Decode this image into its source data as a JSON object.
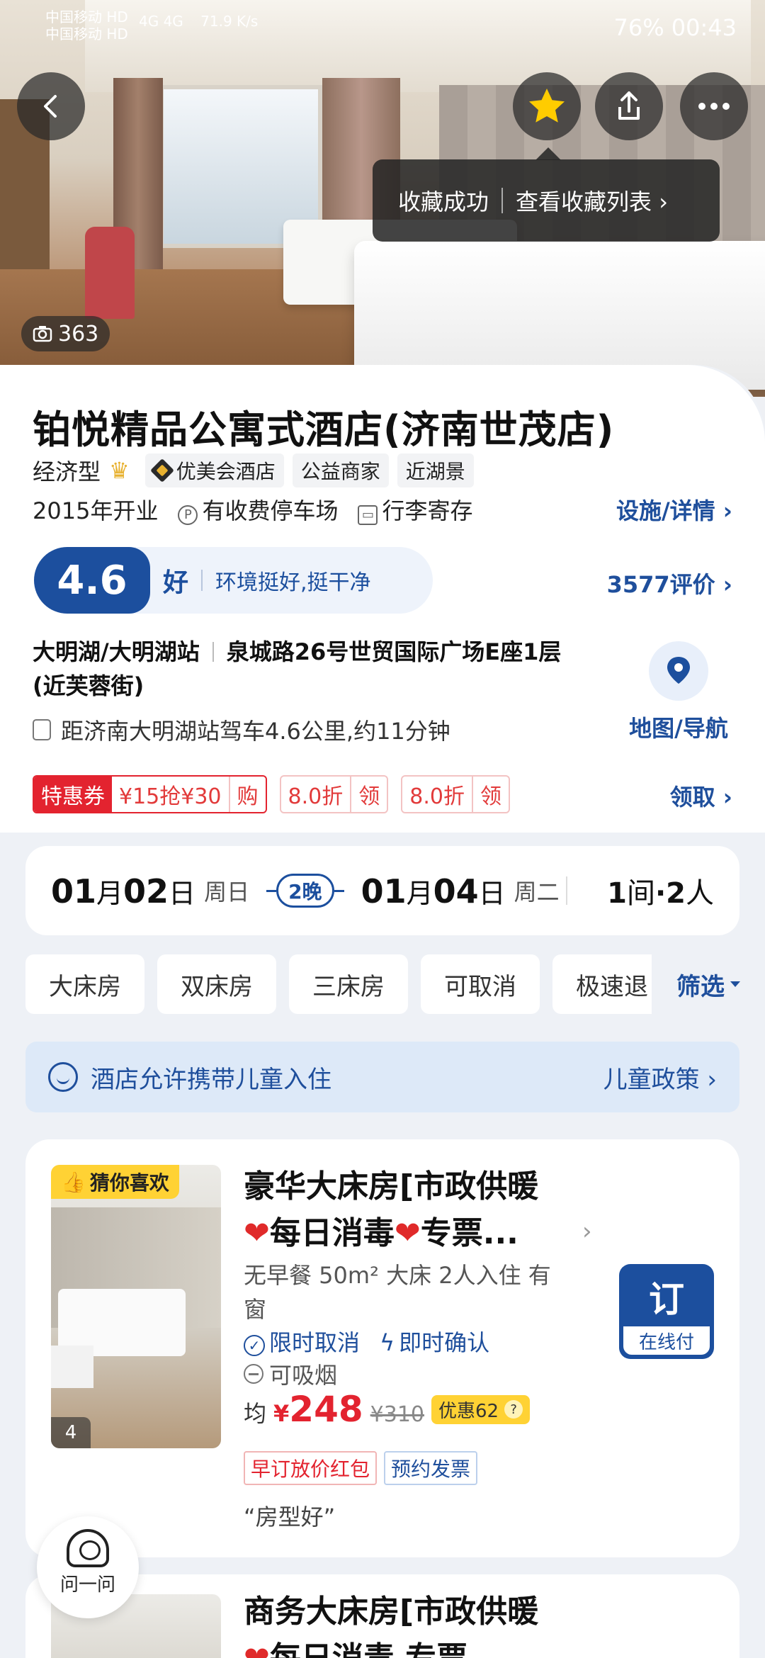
{
  "status_bar": {
    "carrier1": "中国移动 HD",
    "carrier2": "中国移动 HD",
    "signal": "4G 4G",
    "speed": "71.9 K/s",
    "right": "76%  00:43"
  },
  "hero": {
    "photo_count": "363",
    "toast": {
      "saved": "收藏成功",
      "view_list": "查看收藏列表 ›"
    }
  },
  "hotel": {
    "name": "铂悦精品公寓式酒店(济南世茂店)",
    "type": "经济型",
    "tags": [
      "优美会酒店",
      "公益商家",
      "近湖景"
    ],
    "opened": "2015年开业",
    "parking": "有收费停车场",
    "luggage": "行李寄存",
    "facilities_link": "设施/详情 ›",
    "score": "4.6",
    "score_word": "好",
    "score_desc": "环境挺好,挺干净",
    "reviews_link": "3577评价 ›",
    "area": "大明湖/大明湖站",
    "address": "泉城路26号世贸国际广场E座1层(近芙蓉街)",
    "distance": "距济南大明湖站驾车4.6公里,约11分钟",
    "map_label": "地图/导航"
  },
  "coupons": {
    "badge": "特惠券",
    "c1": "¥15抢¥30",
    "c1_action": "购",
    "c2": "8.0折",
    "c2_action": "领",
    "c3": "8.0折",
    "c3_action": "领",
    "link": "领取 ›"
  },
  "dates": {
    "checkin_m": "01",
    "checkin_d": "02",
    "checkin_wd": "周日",
    "nights": "2晚",
    "checkout_m": "01",
    "checkout_d": "04",
    "checkout_wd": "周二",
    "rooms_n": "1",
    "rooms_u": "间",
    "people_n": "2",
    "people_u": "人",
    "mo": "月",
    "day": "日",
    "dot": "·"
  },
  "filters": {
    "chips": [
      "大床房",
      "双床房",
      "三床房",
      "可取消",
      "极速退"
    ],
    "filter": "筛选"
  },
  "child_policy": {
    "text": "酒店允许携带儿童入住",
    "link": "儿童政策 ›"
  },
  "room1": {
    "badge": "猜你喜欢",
    "img_count": "4",
    "title_a": "豪华大床房[市政供暖",
    "title_b": "每日消毒",
    "title_c": "专票...",
    "info": "无早餐  50m²  大床  2人入住  有窗",
    "cancel": "限时取消",
    "confirm": "即时确认",
    "smoke": "可吸烟",
    "avg": "均",
    "yen": "¥",
    "price": "248",
    "orig_price": "¥310",
    "discount": "优惠62",
    "tag1": "早订放价红包",
    "tag2": "预约发票",
    "quote": "“房型好”",
    "book": "订",
    "book_sub": "在线付"
  },
  "room2": {
    "title_a": "商务大床房[市政供暖",
    "title_b": "每日消毒  专票..."
  },
  "assistant": {
    "label": "问一问"
  }
}
